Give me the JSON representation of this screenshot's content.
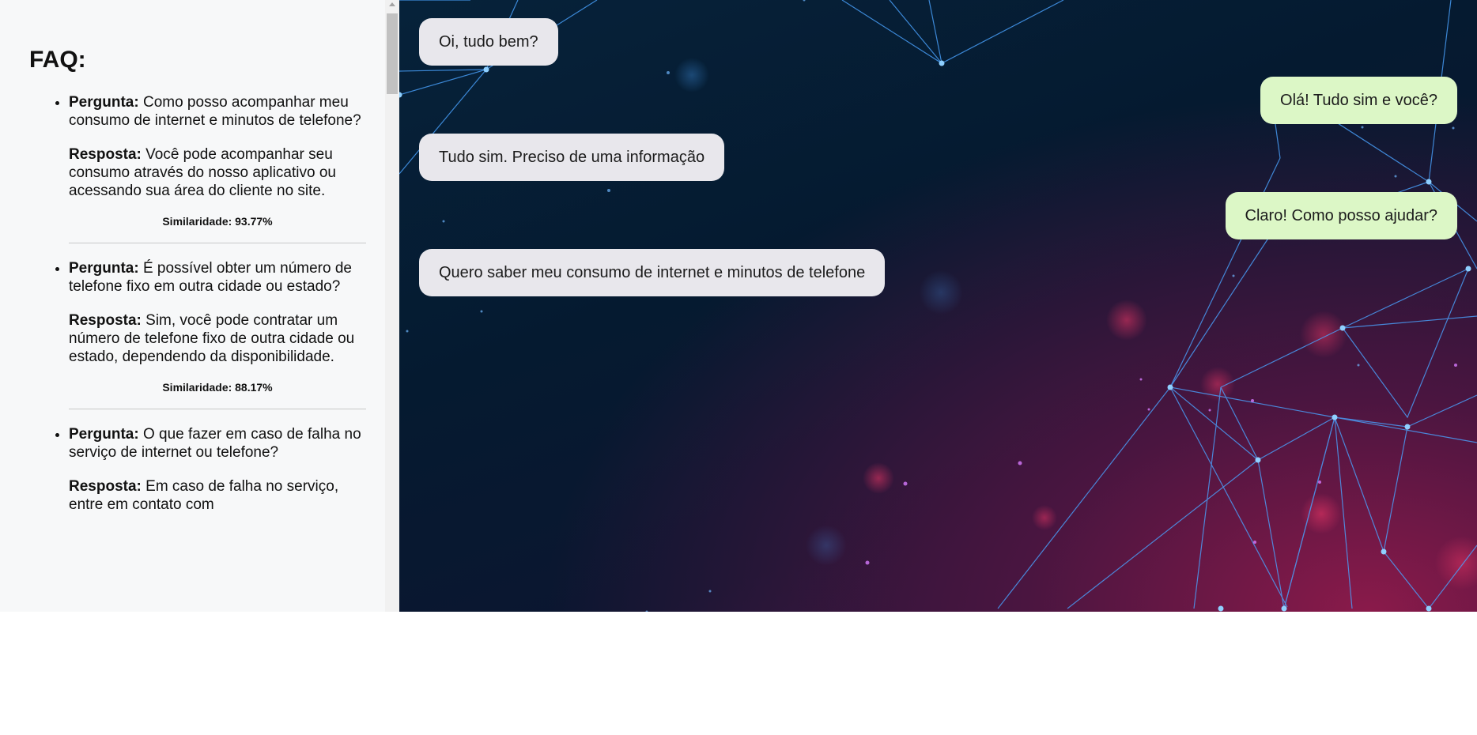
{
  "faq": {
    "title": "FAQ:",
    "items": [
      {
        "question_label": "Pergunta:",
        "question": "Como posso acompanhar meu consumo de internet e minutos de telefone?",
        "answer_label": "Resposta:",
        "answer": "Você pode acompanhar seu consumo através do nosso aplicativo ou acessando sua área do cliente no site.",
        "similarity": "Similaridade: 93.77%"
      },
      {
        "question_label": "Pergunta:",
        "question": "É possível obter um número de telefone fixo em outra cidade ou estado?",
        "answer_label": "Resposta:",
        "answer": "Sim, você pode contratar um número de telefone fixo de outra cidade ou estado, dependendo da disponibilidade.",
        "similarity": "Similaridade: 88.17%"
      },
      {
        "question_label": "Pergunta:",
        "question": "O que fazer em caso de falha no serviço de internet ou telefone?",
        "answer_label": "Resposta:",
        "answer": "Em caso de falha no serviço, entre em contato com"
      }
    ]
  },
  "chat": {
    "messages": [
      {
        "sender": "user",
        "text": "Oi, tudo bem?"
      },
      {
        "sender": "bot",
        "text": "Olá! Tudo sim e você?"
      },
      {
        "sender": "user",
        "text": "Tudo sim. Preciso de uma informação"
      },
      {
        "sender": "bot",
        "text": "Claro! Como posso ajudar?"
      },
      {
        "sender": "user",
        "text": "Quero saber meu consumo de internet e minutos de telefone"
      }
    ]
  },
  "colors": {
    "user_bubble": "#e8e7ec",
    "bot_bubble": "#dcf7c6",
    "sidebar_background": "#f7f8f9",
    "network_lines": "#4aa3ff"
  }
}
